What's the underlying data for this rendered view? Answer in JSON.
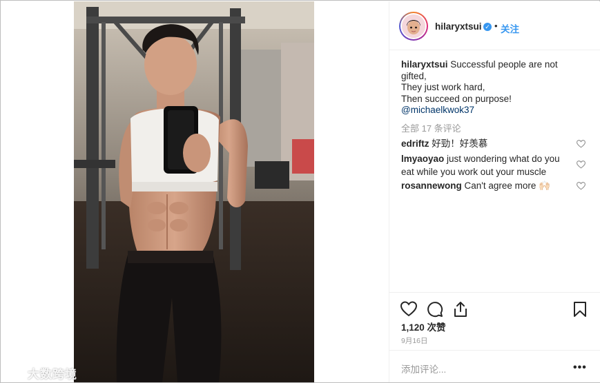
{
  "header": {
    "username": "hilaryxtsui",
    "separator": "•",
    "follow_label": "关注"
  },
  "caption": {
    "username": "hilaryxtsui",
    "line1": "Successful people are not",
    "line2": "gifted,",
    "line3": "They just work hard,",
    "line4": "Then succeed on purpose!",
    "mention": "@michaelkwok37"
  },
  "view_all_comments": "全部 17 条评论",
  "comments": [
    {
      "username": "edriftz",
      "text": "好勁！好羡慕"
    },
    {
      "username": "lmyaoyao",
      "text": "just wondering what do you eat while you work out your muscle"
    },
    {
      "username": "rosannewong",
      "text": "Can't agree more 🙌🏻"
    }
  ],
  "likes": "1,120 次赞",
  "date": "9月16日",
  "add_comment_placeholder": "添加评论...",
  "more_label": "•••",
  "watermark": "大数跨境",
  "colors": {
    "accent": "#3897f0",
    "text": "#262626",
    "muted": "#999999",
    "mention": "#003569"
  },
  "icons": [
    "verified-badge-icon",
    "heart-icon",
    "comment-icon",
    "share-icon",
    "bookmark-icon",
    "more-options-icon"
  ]
}
